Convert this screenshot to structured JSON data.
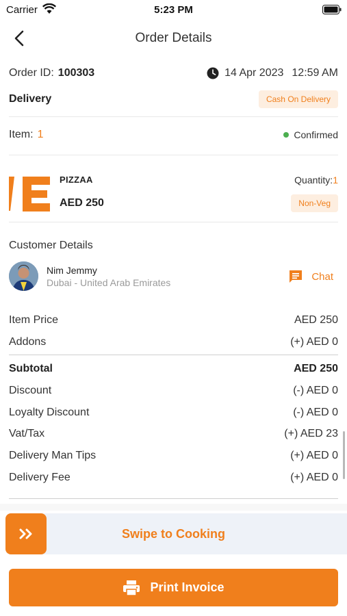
{
  "status_bar": {
    "carrier": "Carrier",
    "time": "5:23 PM"
  },
  "header": {
    "title": "Order Details",
    "back_icon": "chevron-left-icon"
  },
  "order": {
    "id_label": "Order ID:",
    "id": "100303",
    "date": "14 Apr 2023",
    "time": "12:59 AM",
    "type": "Delivery",
    "payment_badge": "Cash On Delivery",
    "item_label": "Item:",
    "item_count": "1",
    "status": "Confirmed",
    "status_color": "#4caf50"
  },
  "product": {
    "name": "PIZZAA",
    "price": "AED 250",
    "quantity_label": "Quantity:",
    "quantity": "1",
    "tag": "Non-Veg"
  },
  "customer": {
    "section_title": "Customer Details",
    "name": "Nim Jemmy",
    "location": "Dubai - United Arab Emirates",
    "chat_label": "Chat"
  },
  "pricing": {
    "rows_top": [
      {
        "label": "Item Price",
        "value": "AED 250"
      },
      {
        "label": "Addons",
        "value": "(+) AED 0"
      }
    ],
    "subtotal": {
      "label": "Subtotal",
      "value": "AED 250"
    },
    "rows_bottom": [
      {
        "label": "Discount",
        "value": "(-) AED 0"
      },
      {
        "label": "Loyalty Discount",
        "value": "(-) AED 0"
      },
      {
        "label": "Vat/Tax",
        "value": "(+) AED 23"
      },
      {
        "label": "Delivery Man Tips",
        "value": "(+) AED 0"
      },
      {
        "label": "Delivery Fee",
        "value": "(+) AED 0"
      }
    ]
  },
  "actions": {
    "swipe_label": "Swipe to Cooking",
    "print_label": "Print Invoice"
  },
  "colors": {
    "accent": "#f07f1c",
    "badge_bg": "#fdeee0"
  }
}
